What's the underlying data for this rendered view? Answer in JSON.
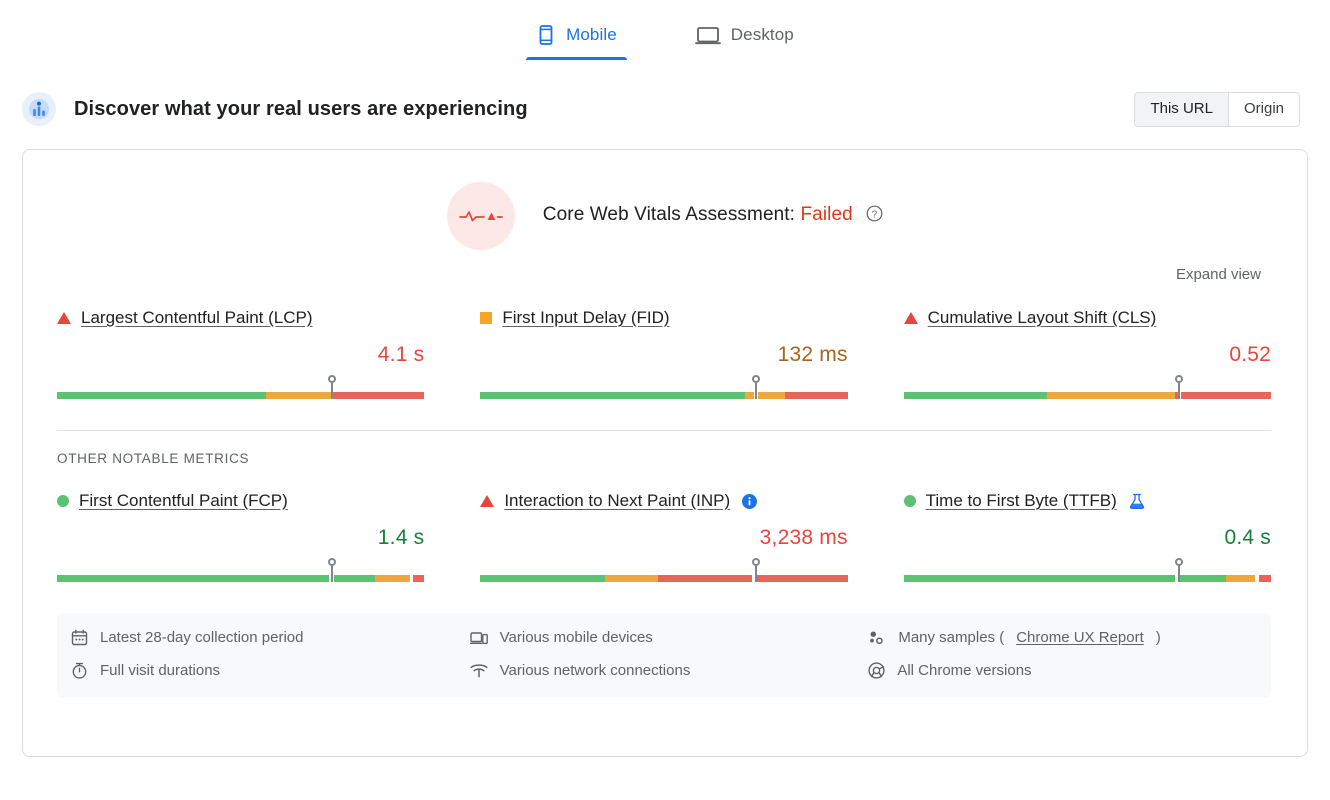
{
  "tabs": [
    {
      "label": "Mobile",
      "icon": "mobile-icon",
      "active": true
    },
    {
      "label": "Desktop",
      "icon": "desktop-icon",
      "active": false
    }
  ],
  "header": {
    "title": "Discover what your real users are experiencing",
    "icon": "field-data-icon",
    "scope": {
      "this_url": "This URL",
      "origin": "Origin",
      "selected": "This URL"
    }
  },
  "assessment": {
    "label": "Core Web Vitals Assessment:",
    "status": "Failed",
    "status_color": "#e63419",
    "icon": "pulse-icon",
    "help_icon": "help-circle-icon"
  },
  "expand_view": "Expand view",
  "other_metrics_label": "OTHER NOTABLE METRICS",
  "core_metrics": [
    {
      "name": "Largest Contentful Paint (LCP)",
      "value": "4.1 s",
      "status": "fail",
      "status_icon": "triangle-icon",
      "value_color": "#e8453c",
      "marker_pct": 75,
      "segments": [
        {
          "color": "green",
          "pct": 57
        },
        {
          "color": "amber",
          "pct": 18
        },
        {
          "color": "red",
          "pct": 25
        }
      ]
    },
    {
      "name": "First Input Delay (FID)",
      "value": "132 ms",
      "status": "average",
      "status_icon": "square-icon",
      "value_color": "#a9631c",
      "marker_pct": 75,
      "segments": [
        {
          "color": "green",
          "pct": 72
        },
        {
          "color": "amber",
          "pct": 2.5
        },
        {
          "color": "gap",
          "pct": 1
        },
        {
          "color": "amber",
          "pct": 7.5
        },
        {
          "color": "red",
          "pct": 17
        }
      ]
    },
    {
      "name": "Cumulative Layout Shift (CLS)",
      "value": "0.52",
      "status": "fail",
      "status_icon": "triangle-icon",
      "value_color": "#e8453c",
      "marker_pct": 75,
      "segments": [
        {
          "color": "green",
          "pct": 39
        },
        {
          "color": "amber",
          "pct": 35
        },
        {
          "color": "red",
          "pct": 0.6
        },
        {
          "color": "gap",
          "pct": 1
        },
        {
          "color": "red",
          "pct": 24.4
        }
      ]
    }
  ],
  "other_metrics": [
    {
      "name": "First Contentful Paint (FCP)",
      "value": "1.4 s",
      "status": "pass",
      "status_icon": "circle-icon",
      "value_color": "#168039",
      "marker_pct": 75,
      "badge": null,
      "segments": [
        {
          "color": "green",
          "pct": 74
        },
        {
          "color": "gap",
          "pct": 1.5
        },
        {
          "color": "green",
          "pct": 11
        },
        {
          "color": "amber",
          "pct": 9.5
        },
        {
          "color": "gap",
          "pct": 0.8
        },
        {
          "color": "red",
          "pct": 3.2
        }
      ]
    },
    {
      "name": "Interaction to Next Paint (INP)",
      "value": "3,238 ms",
      "status": "fail",
      "status_icon": "triangle-icon",
      "value_color": "#e8453c",
      "marker_pct": 75,
      "badge": "info-badge-icon",
      "segments": [
        {
          "color": "green",
          "pct": 34
        },
        {
          "color": "amber",
          "pct": 14.5
        },
        {
          "color": "red",
          "pct": 25.5
        },
        {
          "color": "gap",
          "pct": 1
        },
        {
          "color": "red",
          "pct": 25
        }
      ]
    },
    {
      "name": "Time to First Byte (TTFB)",
      "value": "0.4 s",
      "status": "pass",
      "status_icon": "circle-icon",
      "value_color": "#168039",
      "marker_pct": 75,
      "badge": "experimental-flask-icon",
      "segments": [
        {
          "color": "green",
          "pct": 74
        },
        {
          "color": "gap",
          "pct": 1.2
        },
        {
          "color": "green",
          "pct": 12.5
        },
        {
          "color": "amber",
          "pct": 8
        },
        {
          "color": "gap",
          "pct": 1
        },
        {
          "color": "red",
          "pct": 3.3
        }
      ]
    }
  ],
  "footer": {
    "columns": [
      [
        {
          "icon": "calendar-icon",
          "text": "Latest 28-day collection period"
        },
        {
          "icon": "stopwatch-icon",
          "text": "Full visit durations"
        }
      ],
      [
        {
          "icon": "devices-icon",
          "text": "Various mobile devices"
        },
        {
          "icon": "network-icon",
          "text": "Various network connections"
        }
      ],
      [
        {
          "icon": "samples-icon",
          "text": "Many samples (",
          "link": "Chrome UX Report",
          "text_after": ")"
        },
        {
          "icon": "chrome-icon",
          "text": "All Chrome versions"
        }
      ]
    ]
  },
  "colors": {
    "good": "#5cc271",
    "needs_improvement": "#eda83a",
    "poor": "#e8645a",
    "accent": "#1a73e8"
  }
}
